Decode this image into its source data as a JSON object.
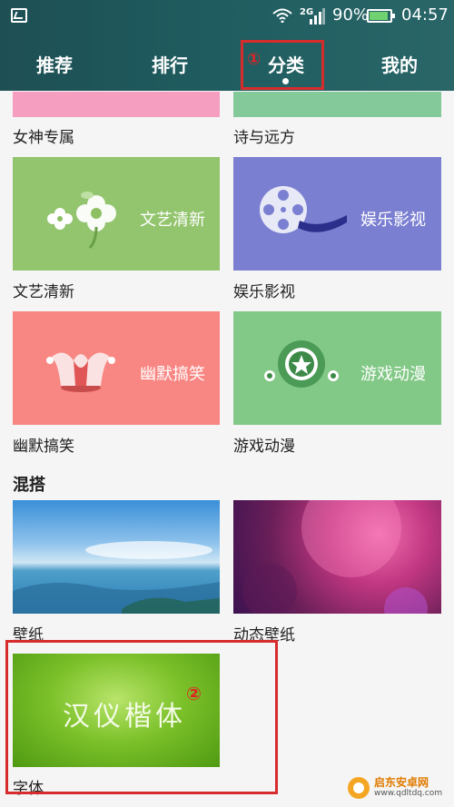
{
  "status": {
    "battery": "90%",
    "time": "04:57",
    "network": "2G"
  },
  "tabs": [
    {
      "label": "推荐"
    },
    {
      "label": "排行"
    },
    {
      "label": "分类"
    },
    {
      "label": "我的"
    }
  ],
  "annotations": {
    "one": "①",
    "two": "②"
  },
  "categories": {
    "row0": {
      "left": "女神专属",
      "right": "诗与远方"
    },
    "row1": {
      "left": "文艺清新",
      "right": "娱乐影视",
      "left_title": "文艺清新",
      "right_title": "娱乐影视"
    },
    "row2": {
      "left": "幽默搞笑",
      "right": "游戏动漫",
      "left_title": "幽默搞笑",
      "right_title": "游戏动漫"
    }
  },
  "mix": {
    "title": "混搭",
    "items": [
      {
        "label": "壁纸"
      },
      {
        "label": "动态壁纸"
      },
      {
        "label": "字体",
        "banner": "汉仪楷体"
      }
    ]
  },
  "watermark": {
    "name": "启东安卓网",
    "url": "www.qdltdq.com"
  },
  "colors": {
    "accent": "#1f5d60",
    "highlight": "#d62c2c"
  }
}
